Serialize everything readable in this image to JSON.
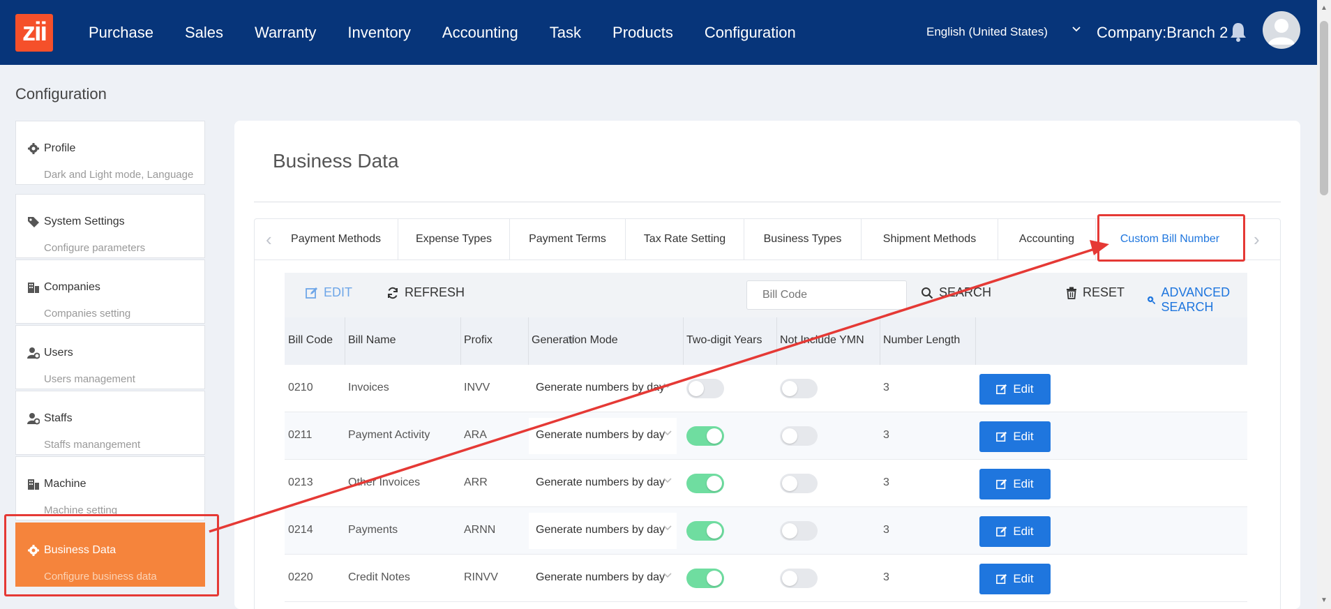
{
  "app": {
    "logo_text": "zii",
    "nav": [
      "Purchase",
      "Sales",
      "Warranty",
      "Inventory",
      "Accounting",
      "Task",
      "Products",
      "Configuration"
    ],
    "language": "English (United States)",
    "company": "Company:Branch 2"
  },
  "breadcrumb": "Configuration",
  "sidebar": {
    "items": [
      {
        "title": "Profile",
        "subtitle": "Dark and Light mode, Language",
        "icon": "gear-icon"
      },
      {
        "title": "System Settings",
        "subtitle": "Configure parameters",
        "icon": "tag-icon"
      },
      {
        "title": "Companies",
        "subtitle": "Companies setting",
        "icon": "building-icon"
      },
      {
        "title": "Users",
        "subtitle": "Users management",
        "icon": "user-gear-icon"
      },
      {
        "title": "Staffs",
        "subtitle": "Staffs manangement",
        "icon": "user-gear-icon"
      },
      {
        "title": "Machine",
        "subtitle": "Machine setting",
        "icon": "building-icon"
      },
      {
        "title": "Business Data",
        "subtitle": "Configure business data",
        "icon": "gear-icon",
        "active": true
      }
    ]
  },
  "main": {
    "title": "Business Data",
    "tabs": [
      "Payment Methods",
      "Expense Types",
      "Payment Terms",
      "Tax Rate Setting",
      "Business Types",
      "Shipment Methods",
      "Accounting",
      "Custom Bill Number"
    ],
    "active_tab": "Custom Bill Number",
    "toolbar": {
      "edit": "EDIT",
      "refresh": "REFRESH",
      "search_placeholder": "Bill Code",
      "search": "SEARCH",
      "reset": "RESET",
      "advanced_search": "ADVANCED SEARCH"
    },
    "table": {
      "columns": [
        "Bill Code",
        "Bill Name",
        "Profix",
        "Generation Mode",
        "Two-digit Years",
        "Not Include YMN",
        "Number Length"
      ],
      "edit_label": "Edit",
      "rows": [
        {
          "code": "0210",
          "name": "Invoices",
          "prefix": "INVV",
          "mode": "Generate numbers by day",
          "two_digit": false,
          "not_include": false,
          "length": "3"
        },
        {
          "code": "0211",
          "name": "Payment Activity",
          "prefix": "ARA",
          "mode": "Generate numbers by day",
          "two_digit": true,
          "not_include": false,
          "length": "3"
        },
        {
          "code": "0213",
          "name": "Other Invoices",
          "prefix": "ARR",
          "mode": "Generate numbers by day",
          "two_digit": true,
          "not_include": false,
          "length": "3"
        },
        {
          "code": "0214",
          "name": "Payments",
          "prefix": "ARNN",
          "mode": "Generate numbers by day",
          "two_digit": true,
          "not_include": false,
          "length": "3"
        },
        {
          "code": "0220",
          "name": "Credit Notes",
          "prefix": "RINVV",
          "mode": "Generate numbers by day",
          "two_digit": true,
          "not_include": false,
          "length": "3"
        }
      ]
    }
  },
  "colors": {
    "topbar": "#07357a",
    "accent": "#1f76de",
    "active_sidebar": "#f5843c",
    "toggle_on": "#6fdda0",
    "annotation": "#e53935"
  }
}
